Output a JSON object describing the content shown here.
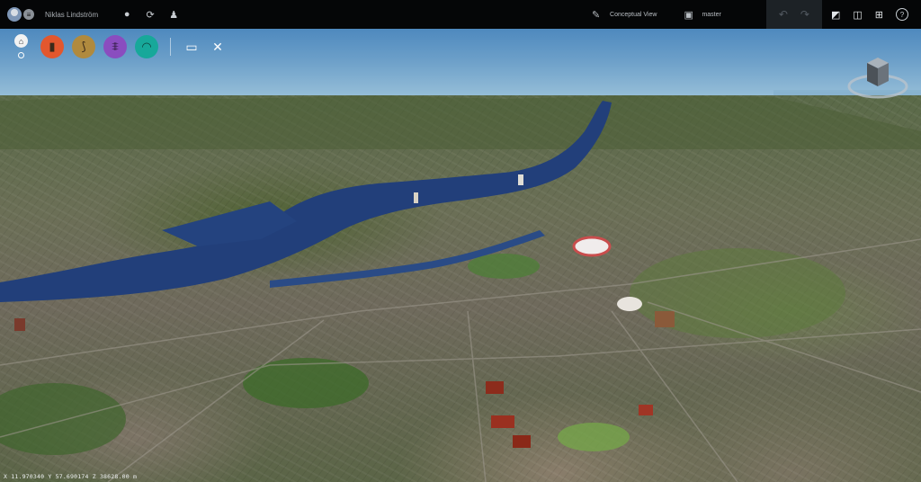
{
  "header": {
    "user_name": "Niklas Lindström",
    "view_mode_label": "Conceptual View",
    "branch_label": "master"
  },
  "icons": {
    "avatar": "user-avatar",
    "menu": "hamburger-menu-icon",
    "record": "circle-icon",
    "sync": "sync-icon",
    "account": "person-icon",
    "view_mode": "pencil-ruler-icon",
    "branch": "image-frame-icon",
    "undo": "undo-icon",
    "redo": "redo-icon",
    "right_toolbar": [
      "edit-square-icon",
      "split-panel-icon",
      "grid-4-icon",
      "help-icon"
    ]
  },
  "toolbar": {
    "buttons": [
      {
        "name": "home-button",
        "icon": "home-icon",
        "color": "#f2f2f2"
      },
      {
        "name": "infrastructure-button",
        "icon": "bollard-icon",
        "color": "#e2572e"
      },
      {
        "name": "road-button",
        "icon": "road-icon",
        "color": "#b08a3e"
      },
      {
        "name": "bridge-button",
        "icon": "bridge-icon",
        "color": "#8a4dbf"
      },
      {
        "name": "tunnel-button",
        "icon": "tunnel-icon",
        "color": "#17a89a"
      }
    ],
    "extra": [
      "presentation-icon",
      "tools-icon"
    ]
  },
  "status": {
    "coordinates": "X 11.970340 Y 57.690174 Z 38628.00 m"
  },
  "colors": {
    "water": "#1f3f7d",
    "sky": "#5a92c4",
    "topbar": "#050607"
  }
}
